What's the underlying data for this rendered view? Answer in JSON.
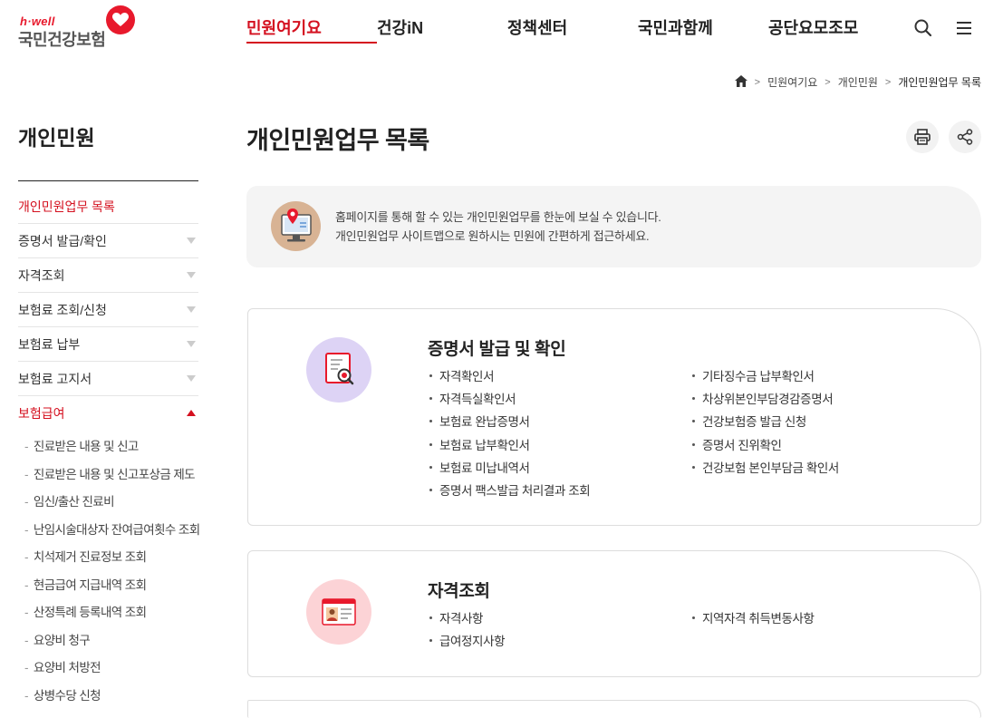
{
  "logo": {
    "hwell": "h·well",
    "name": "국민건강보험"
  },
  "gnb": [
    {
      "label": "민원여기요",
      "active": true
    },
    {
      "label": "건강iN"
    },
    {
      "label": "정책센터"
    },
    {
      "label": "국민과함께"
    },
    {
      "label": "공단요모조모"
    }
  ],
  "icons": {
    "search": "search-icon",
    "menu": "hamburger-menu-icon",
    "home": "home-icon",
    "print": "print-icon",
    "share": "share-icon"
  },
  "breadcrumb": {
    "item1": "민원여기요",
    "item2": "개인민원",
    "current": "개인민원업무 목록"
  },
  "sidebar": {
    "title": "개인민원",
    "items": [
      {
        "label": "개인민원업무 목록"
      },
      {
        "label": "증명서 발급/확인"
      },
      {
        "label": "자격조회"
      },
      {
        "label": "보험료 조회/신청"
      },
      {
        "label": "보험료 납부"
      },
      {
        "label": "보험료 고지서"
      },
      {
        "label": "보험급여"
      }
    ],
    "sub_items": [
      "진료받은 내용 및 신고",
      "진료받은 내용 및 신고포상금 제도",
      "임신/출산 진료비",
      "난임시술대상자 잔여급여횟수 조회",
      "치석제거 진료정보 조회",
      "현금급여 지급내역 조회",
      "산정특례 등록내역 조회",
      "요양비 청구",
      "요양비 처방전",
      "상병수당 신청"
    ]
  },
  "page": {
    "title": "개인민원업무 목록",
    "intro_line1": "홈페이지를 통해 할 수 있는 개인민원업무를 한눈에 보실 수 있습니다.",
    "intro_line2": "개인민원업무 사이트맵으로 원하시는 민원에 간편하게 접근하세요."
  },
  "cards": [
    {
      "title": "증명서 발급 및 확인",
      "left": [
        "자격확인서",
        "자격득실확인서",
        "보험료 완납증명서",
        "보험료 납부확인서",
        "보험료 미납내역서",
        "증명서 팩스발급 처리결과 조회"
      ],
      "right": [
        "기타징수금 납부확인서",
        "차상위본인부담경감증명서",
        "건강보험증 발급 신청",
        "증명서 진위확인",
        "건강보험 본인부담금 확인서"
      ]
    },
    {
      "title": "자격조회",
      "left": [
        "자격사항",
        "급여정지사항"
      ],
      "right": [
        "지역자격 취득변동사항"
      ]
    }
  ],
  "colors": {
    "brand_red": "#d4101f",
    "card1_icon_bg": "#ddd3f5",
    "card2_icon_bg": "#fcd3d6",
    "intro_icon_bg": "#d8b394"
  }
}
